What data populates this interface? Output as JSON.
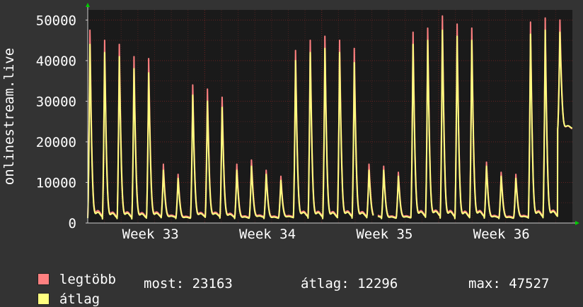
{
  "chart_data": {
    "type": "area",
    "ylabel": "onlinestream.live",
    "ylim": [
      0,
      52500
    ],
    "yticks": [
      0,
      10000,
      20000,
      30000,
      40000,
      50000
    ],
    "ytick_labels": [
      "0",
      "10000",
      "20000",
      "30000",
      "40000",
      "50000"
    ],
    "xlim_days": [
      0,
      29
    ],
    "xtick_labels": [
      "Week 33",
      "Week 34",
      "Week 35",
      "Week 36"
    ],
    "xtick_days": [
      3.5,
      10.5,
      17.5,
      24.5
    ],
    "grid": true,
    "colors": {
      "background": "#333333",
      "plot_background": "#1a1a1a",
      "grid_major": "#662222",
      "grid_minor": "#4a2222",
      "max_series": "#ff8080",
      "avg_series": "#ffff80",
      "axis_arrow": "#00cc00"
    },
    "series": [
      {
        "name": "legtöbb",
        "daily_peaks": [
          47500,
          45000,
          44000,
          41000,
          40500,
          14500,
          12000,
          34000,
          33000,
          31000,
          14500,
          15500,
          13000,
          11500,
          42500,
          45000,
          46000,
          45000,
          43000,
          14500,
          14000,
          12500,
          47000,
          48000,
          51000,
          49000,
          48000,
          15000,
          12500,
          12000,
          49500,
          50500,
          50000
        ],
        "daily_troughs": [
          1500,
          1200,
          1300,
          1200,
          1400,
          1500,
          1300,
          1500,
          1600,
          1400,
          1300,
          1500,
          1300,
          1500,
          1500,
          1400,
          1300,
          1500,
          1400,
          1500,
          1300,
          1400,
          1500,
          1600,
          1400,
          1300,
          1500,
          1400,
          1300,
          1500,
          1400,
          1500,
          23000
        ]
      },
      {
        "name": "átlag",
        "daily_peaks": [
          44000,
          42000,
          41000,
          38000,
          37000,
          13000,
          11000,
          31500,
          30000,
          28500,
          13000,
          14000,
          12000,
          10500,
          40000,
          42000,
          43000,
          42000,
          39500,
          13000,
          13000,
          11500,
          44000,
          45000,
          47500,
          46000,
          45000,
          14000,
          11500,
          11000,
          46500,
          47500,
          47000
        ],
        "daily_troughs": [
          1200,
          1000,
          1100,
          1000,
          1200,
          1300,
          1100,
          1300,
          1400,
          1200,
          1100,
          1300,
          1100,
          1300,
          1300,
          1200,
          1100,
          1300,
          1200,
          1300,
          1100,
          1200,
          1300,
          1400,
          1200,
          1100,
          1300,
          1200,
          1100,
          1300,
          1200,
          1300,
          23163
        ]
      }
    ],
    "gap_day": 17.1
  },
  "legend": [
    {
      "label": "legtöbb",
      "color": "#ff8080"
    },
    {
      "label": "átlag",
      "color": "#ffff80"
    }
  ],
  "stats": {
    "now": "most: 23163",
    "avg": "átlag: 12296",
    "max": "max: 47527"
  }
}
